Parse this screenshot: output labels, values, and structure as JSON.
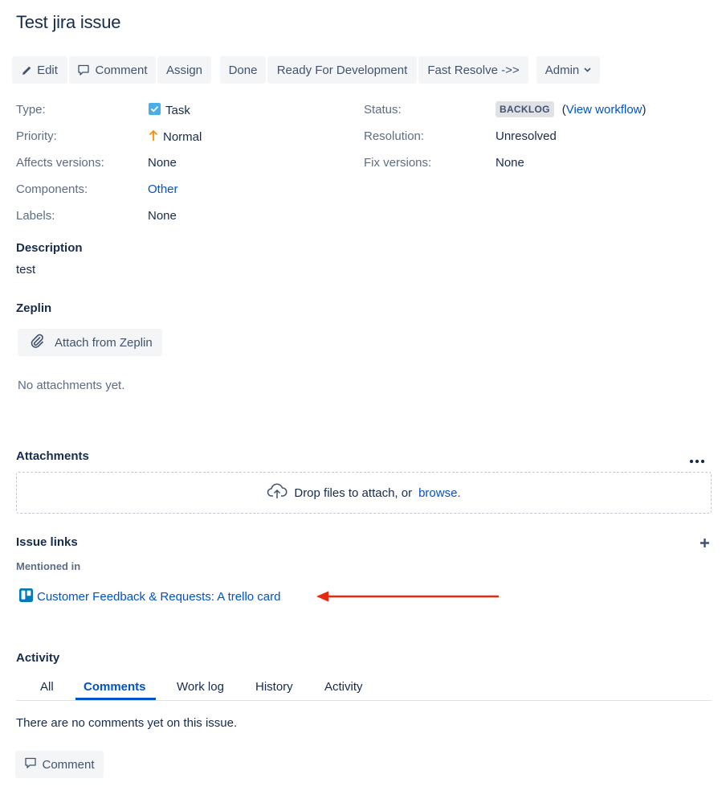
{
  "issue": {
    "title": "Test jira issue"
  },
  "toolbar": {
    "edit": "Edit",
    "comment": "Comment",
    "assign": "Assign",
    "done": "Done",
    "ready": "Ready For Development",
    "fast_resolve": "Fast Resolve ->>",
    "admin": "Admin"
  },
  "details": {
    "type_label": "Type:",
    "type_value": "Task",
    "priority_label": "Priority:",
    "priority_value": "Normal",
    "affects_label": "Affects versions:",
    "affects_value": "None",
    "components_label": "Components:",
    "components_value": "Other",
    "labels_label": "Labels:",
    "labels_value": "None",
    "status_label": "Status:",
    "status_value": "BACKLOG",
    "view_workflow": "View workflow",
    "paren_open": "(",
    "paren_close": ")",
    "resolution_label": "Resolution:",
    "resolution_value": "Unresolved",
    "fix_label": "Fix versions:",
    "fix_value": "None"
  },
  "description": {
    "heading": "Description",
    "text": "test"
  },
  "zeplin": {
    "heading": "Zeplin",
    "button": "Attach from Zeplin",
    "empty": "No attachments yet."
  },
  "attachments": {
    "heading": "Attachments",
    "drop_text": "Drop files to attach, or",
    "browse": "browse."
  },
  "issue_links": {
    "heading": "Issue links",
    "mentioned_in": "Mentioned in",
    "link_text": "Customer Feedback & Requests: A trello card"
  },
  "activity": {
    "heading": "Activity",
    "tabs": [
      "All",
      "Comments",
      "Work log",
      "History",
      "Activity"
    ],
    "active_tab": "Comments",
    "empty": "There are no comments yet on this issue.",
    "comment_button": "Comment"
  },
  "colors": {
    "link": "#0052cc",
    "arrow": "#e8290b",
    "task_icon": "#4bade8",
    "priority_arrow": "#ff8b00",
    "trello": "#0079bf"
  },
  "icons": {
    "edit": "pencil-icon",
    "comment": "speech-bubble-icon",
    "admin": "chevron-down-icon",
    "task": "checkbox-task-icon",
    "priority": "arrow-up-icon",
    "zeplin": "paperclip-icon",
    "attachments_more": "more-dots-icon",
    "upload": "cloud-upload-icon",
    "add_link": "plus-icon",
    "trello": "trello-icon"
  }
}
